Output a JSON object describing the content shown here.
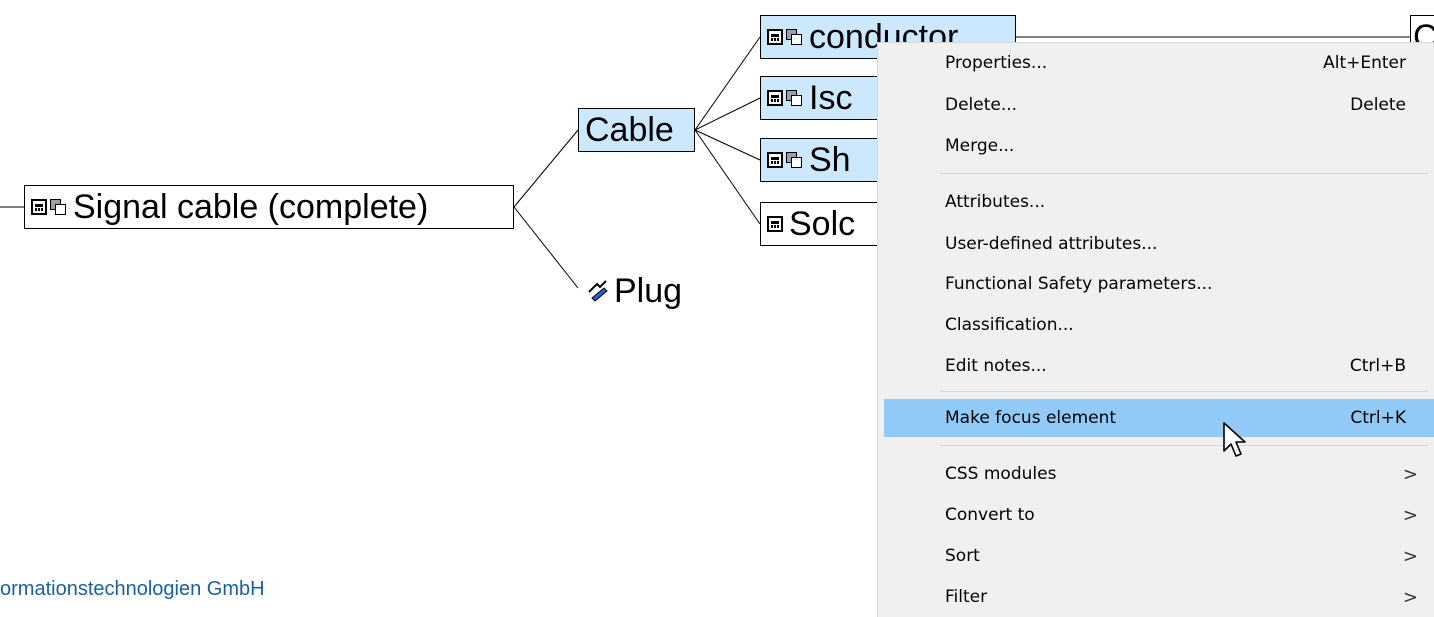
{
  "tree": {
    "root": "Signal cable (complete)",
    "cable": "Cable",
    "plug": "Plug",
    "children": [
      "conductor",
      "Isc",
      "Sh",
      "Solc"
    ],
    "partial_right": "C"
  },
  "footer_text": "ormationstechnologien GmbH",
  "context_menu": {
    "items": [
      {
        "label": "Properties...",
        "shortcut": "Alt+Enter"
      },
      {
        "label": "Delete...",
        "shortcut": "Delete"
      },
      {
        "label": "Merge...",
        "shortcut": ""
      },
      {
        "label": "Attributes...",
        "shortcut": ""
      },
      {
        "label": "User-defined attributes...",
        "shortcut": ""
      },
      {
        "label": "Functional Safety parameters...",
        "shortcut": ""
      },
      {
        "label": "Classification...",
        "shortcut": ""
      },
      {
        "label": "Edit notes...",
        "shortcut": "Ctrl+B"
      },
      {
        "label": "Make focus element",
        "shortcut": "Ctrl+K"
      },
      {
        "label": "CSS modules",
        "submenu_arrow": ">"
      },
      {
        "label": "Convert to",
        "submenu_arrow": ">"
      },
      {
        "label": "Sort",
        "submenu_arrow": ">"
      },
      {
        "label": "Filter",
        "submenu_arrow": ">"
      }
    ],
    "highlighted_item": "Make focus element"
  },
  "colors": {
    "selected_node_bg": "#cce8ff",
    "menu_bg": "#f0f0f0",
    "menu_highlight": "#91c9f7",
    "footer_text": "#1b5f9e"
  }
}
